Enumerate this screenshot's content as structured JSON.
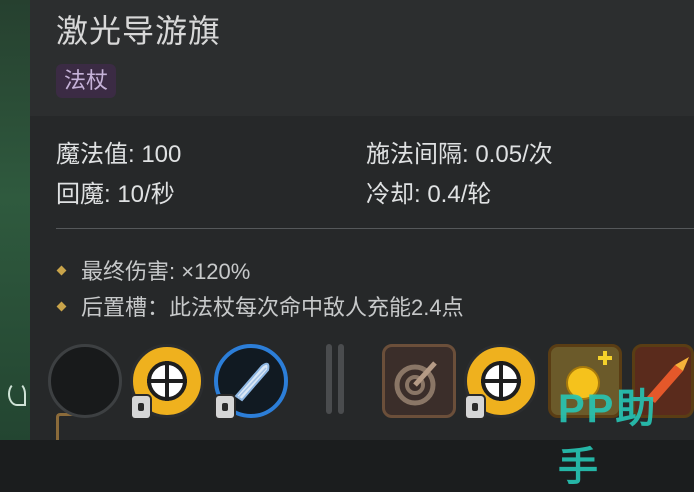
{
  "item": {
    "title": "激光导游旗",
    "tag": "法杖"
  },
  "stats": {
    "mana": "魔法值: 100",
    "cast_interval": "施法间隔: 0.05/次",
    "mana_regen": "回魔: 10/秒",
    "cooldown": "冷却: 0.4/轮"
  },
  "effects": [
    "最终伤害: ×120%",
    "后置槽：此法杖每次命中敌人充能2.4点"
  ],
  "slots": [
    {
      "icon": "empty-slot-icon",
      "locked": false
    },
    {
      "icon": "crosshair-icon",
      "locked": true
    },
    {
      "icon": "feather-blade-icon",
      "locked": true
    },
    {
      "icon": "arrow-target-icon",
      "locked": false
    },
    {
      "icon": "crosshair-icon",
      "locked": true
    },
    {
      "icon": "gold-coin-plus-icon",
      "locked": false
    },
    {
      "icon": "flame-rocket-icon",
      "locked": false
    }
  ],
  "watermark": "PP助手",
  "colors": {
    "tag_bg": "#3b2b44",
    "bullet_accent": "#c9a44a",
    "watermark": "#27c6b5"
  }
}
